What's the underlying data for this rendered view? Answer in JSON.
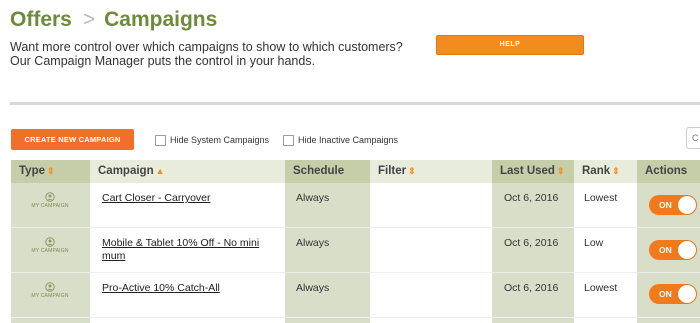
{
  "breadcrumb": {
    "parent": "Offers",
    "separator": ">",
    "current": "Campaigns"
  },
  "intro": {
    "line1": "Want more control over which campaigns to show to which customers?",
    "line2": "Our Campaign Manager puts the control in your hands."
  },
  "help_button": "HELP",
  "toolbar": {
    "create_label": "CREATE NEW CAMPAIGN",
    "hide_system_label": "Hide System Campaigns",
    "hide_system_checked": false,
    "hide_inactive_label": "Hide Inactive Campaigns",
    "hide_inactive_checked": false,
    "right_control_text": "C"
  },
  "table": {
    "headers": {
      "type": "Type",
      "campaign": "Campaign",
      "schedule": "Schedule",
      "filter": "Filter",
      "last_used": "Last Used",
      "rank": "Rank",
      "actions": "Actions"
    },
    "rows": [
      {
        "type_label": "MY CAMPAIGN",
        "campaign": "Cart Closer - Carryover",
        "schedule": "Always",
        "filter": "",
        "last_used": "Oct 6, 2016",
        "rank": "Lowest",
        "toggle": "ON"
      },
      {
        "type_label": "MY CAMPAIGN",
        "campaign": "Mobile & Tablet 10% Off - No mini mum",
        "schedule": "Always",
        "filter": "",
        "last_used": "Oct 6, 2016",
        "rank": "Low",
        "toggle": "ON"
      },
      {
        "type_label": "MY CAMPAIGN",
        "campaign": "Pro-Active 10% Catch-All",
        "schedule": "Always",
        "filter": "",
        "last_used": "Oct 6, 2016",
        "rank": "Lowest",
        "toggle": "ON"
      }
    ]
  },
  "colors": {
    "brand_green": "#6e8a3c",
    "accent_orange": "#f28c1f",
    "create_orange": "#f0702b",
    "shaded_column": "#d9dec8"
  },
  "icons": {
    "type": "user-icon",
    "sort": "sort-arrows-icon",
    "sort_asc": "sort-up-icon"
  }
}
